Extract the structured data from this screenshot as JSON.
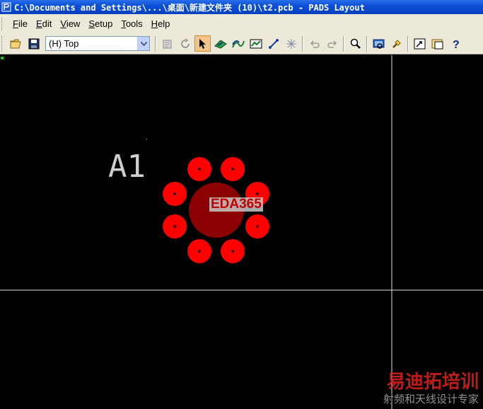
{
  "window": {
    "title": "C:\\Documents and Settings\\...\\桌面\\新建文件夹 (10)\\t2.pcb - PADS Layout"
  },
  "menu": {
    "items": [
      {
        "label_ul": "F",
        "label_rest": "ile"
      },
      {
        "label_ul": "E",
        "label_rest": "dit"
      },
      {
        "label_ul": "V",
        "label_rest": "iew"
      },
      {
        "label_ul": "S",
        "label_rest": "etup"
      },
      {
        "label_ul": "T",
        "label_rest": "ools"
      },
      {
        "label_ul": "H",
        "label_rest": "elp"
      }
    ]
  },
  "toolbar": {
    "layer_value": "(H) Top",
    "icons": [
      "open-folder-icon",
      "save-icon",
      "layer-dropdown",
      "properties-icon",
      "redraw-icon",
      "select-arrow-icon",
      "design-toolbar-icon",
      "ecodesign-icon",
      "drafting-icon",
      "dimension-icon",
      "bga-icon",
      "undo-icon",
      "redo-icon",
      "zoom-icon",
      "view-icon",
      "hatch-icon",
      "session-icon",
      "output-icon",
      "help-icon"
    ]
  },
  "canvas": {
    "component_label": "A1",
    "watermark_text": "EDA365",
    "colors": {
      "background": "#000000",
      "pad": "#ff0000",
      "center_pad": "#8b0000",
      "label": "#cfcfcf",
      "crosshair": "#ffffff"
    }
  },
  "branding": {
    "logo_text": "易迪拓培训",
    "sub_text": "射频和天线设计专家"
  }
}
